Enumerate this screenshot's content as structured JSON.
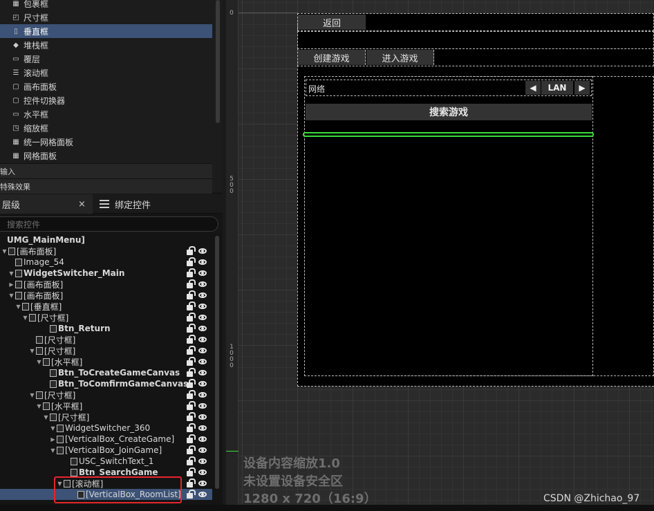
{
  "palette": {
    "items": [
      {
        "label": "包裹框",
        "icon": "wrap-box-icon"
      },
      {
        "label": "尺寸框",
        "icon": "size-box-icon"
      },
      {
        "label": "垂直框",
        "icon": "vertical-box-icon",
        "selected": true
      },
      {
        "label": "堆栈框",
        "icon": "stack-box-icon"
      },
      {
        "label": "覆层",
        "icon": "overlay-icon"
      },
      {
        "label": "滚动框",
        "icon": "scroll-box-icon"
      },
      {
        "label": "画布面板",
        "icon": "canvas-panel-icon"
      },
      {
        "label": "控件切换器",
        "icon": "widget-switcher-icon"
      },
      {
        "label": "水平框",
        "icon": "horizontal-box-icon"
      },
      {
        "label": "缩放框",
        "icon": "scale-box-icon"
      },
      {
        "label": "统一网格面板",
        "icon": "uniform-grid-icon"
      },
      {
        "label": "网格面板",
        "icon": "grid-panel-icon"
      }
    ],
    "categories": [
      "输入",
      "特殊效果"
    ]
  },
  "tabs": {
    "hierarchy": "层级",
    "close": "×",
    "bind_widgets": "绑定控件"
  },
  "search": {
    "placeholder": "搜索控件"
  },
  "tree": [
    {
      "label": "UMG_MainMenu]",
      "bold": true,
      "arrow": ""
    },
    {
      "label": "[画布面板]",
      "arrow": "▼"
    },
    {
      "label": "Image_54",
      "arrow": ""
    },
    {
      "label": "WidgetSwitcher_Main",
      "bold": true,
      "arrow": "▼"
    },
    {
      "label": "[画布面板]",
      "arrow": "▶"
    },
    {
      "label": "[画布面板]",
      "arrow": "▼"
    },
    {
      "label": "[垂直框]",
      "arrow": "▼"
    },
    {
      "label": "[尺寸框]",
      "arrow": "▼"
    },
    {
      "label": "Btn_Return",
      "bold": true,
      "arrow": ""
    },
    {
      "label": "[尺寸框]",
      "arrow": ""
    },
    {
      "label": "[尺寸框]",
      "arrow": "▼"
    },
    {
      "label": "[水平框]",
      "arrow": "▼"
    },
    {
      "label": "Btn_ToCreateGameCanvas",
      "bold": true,
      "arrow": ""
    },
    {
      "label": "Btn_ToComfirmGameCanvas",
      "bold": true,
      "arrow": ""
    },
    {
      "label": "[尺寸框]",
      "arrow": "▼"
    },
    {
      "label": "[水平框]",
      "arrow": "▼"
    },
    {
      "label": "[尺寸框]",
      "arrow": "▼"
    },
    {
      "label": "WidgetSwitcher_360",
      "arrow": "▼"
    },
    {
      "label": "[VerticalBox_CreateGame]",
      "arrow": "▶"
    },
    {
      "label": "[VerticalBox_JoinGame]",
      "arrow": "▼"
    },
    {
      "label": "USC_SwitchText_1",
      "arrow": ""
    },
    {
      "label": "Btn_SearchGame",
      "bold": true,
      "arrow": ""
    },
    {
      "label": "[滚动框]",
      "arrow": "▼"
    },
    {
      "label": "[VerticalBox_RoomList]",
      "arrow": "",
      "selected": true
    }
  ],
  "designer": {
    "btn_return": "返回",
    "btn_create_game": "创建游戏",
    "btn_join_game": "进入游戏",
    "network_label": "网络",
    "network_value": "LAN",
    "btn_search_game": "搜索游戏",
    "ruler_labels": [
      "0",
      "5\n0\n0",
      "1\n0\n0\n0"
    ],
    "info_line1": "设备内容缩放1.0",
    "info_line2": "未设置设备安全区",
    "info_line3": "1280 x 720（16:9）"
  },
  "watermark": "CSDN @Zhichao_97",
  "colors": {
    "selection": "#3c5276",
    "highlight_green": "#3cdc3c",
    "annotation_red": "#e8242b"
  }
}
